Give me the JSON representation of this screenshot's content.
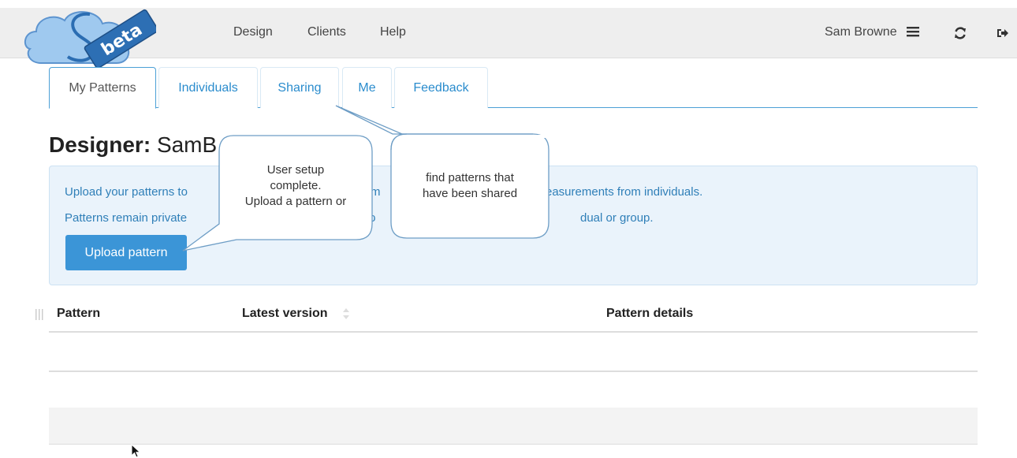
{
  "logo": {
    "text": "beta"
  },
  "navbar": {
    "links": [
      "Design",
      "Clients",
      "Help"
    ],
    "user_name": "Sam Browne",
    "menu_icon": "hamburger-icon",
    "refresh_icon": "refresh-icon",
    "logout_icon": "logout-icon"
  },
  "tabs": [
    {
      "label": "My Patterns",
      "active": true
    },
    {
      "label": "Individuals",
      "active": false
    },
    {
      "label": "Sharing",
      "active": false
    },
    {
      "label": "Me",
      "active": false
    },
    {
      "label": "Feedback",
      "active": false
    }
  ],
  "page": {
    "title_bold": "Designer:",
    "title_name": "SamB"
  },
  "info_panel": {
    "line1_start": "Upload your patterns to",
    "line1_mid": "m",
    "line1_end": "easurements from individuals.",
    "line2_start": "Patterns remain private",
    "line2_mid": "to",
    "line2_end": "dual or group.",
    "upload_button": "Upload pattern"
  },
  "callouts": {
    "setup": [
      "User setup",
      "complete.",
      "Upload a pattern or"
    ],
    "sharing": [
      "find patterns that",
      "have been shared"
    ]
  },
  "table": {
    "headers": {
      "pattern": "Pattern",
      "latest_version": "Latest version",
      "pattern_details": "Pattern details"
    }
  },
  "colors": {
    "accent": "#3b95d7",
    "tab_text": "#2a8ccd",
    "panel_bg": "#eaf3fb"
  }
}
